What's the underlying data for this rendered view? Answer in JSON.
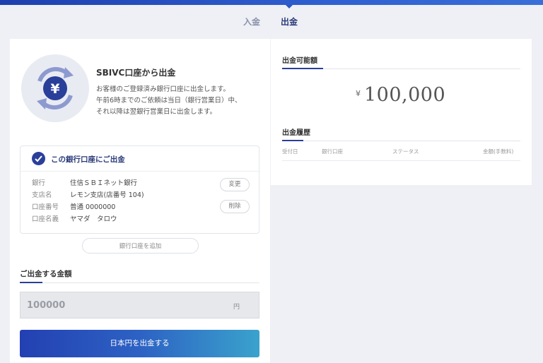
{
  "tabs": {
    "deposit": "入金",
    "withdraw": "出金"
  },
  "hero": {
    "title": "SBIVC口座から出金",
    "desc_lines": [
      "お客様のご登録済み銀行口座に出金します。",
      "午前6時までのご依頼は当日（銀行営業日）中、",
      "それ以降は翌銀行営業日に出金します。"
    ],
    "icon": "yen-exchange-icon"
  },
  "bank_card": {
    "title": "この銀行口座にご出金",
    "rows": [
      {
        "label": "銀行",
        "value": "住信ＳＢＩネット銀行"
      },
      {
        "label": "支店名",
        "value": "レモン支店(店番号 104)"
      },
      {
        "label": "口座番号",
        "value": "普通 0000000"
      },
      {
        "label": "口座名義",
        "value": "ヤマダ　タロウ"
      }
    ],
    "edit_label": "変更",
    "delete_label": "削除"
  },
  "add_bank_label": "銀行口座を追加",
  "amount_section": {
    "title": "ご出金する金額",
    "value": "100000",
    "unit": "円"
  },
  "submit_label": "日本円を出金する",
  "available": {
    "title": "出金可能額",
    "currency": "¥",
    "amount": "100,000"
  },
  "history": {
    "title": "出金履歴",
    "columns": [
      "受付日",
      "銀行口座",
      "ステータス",
      "金額(手数料)"
    ]
  },
  "colors": {
    "accent": "#2a3f9a",
    "button_start": "#2340b2",
    "button_end": "#3aa2cc"
  }
}
